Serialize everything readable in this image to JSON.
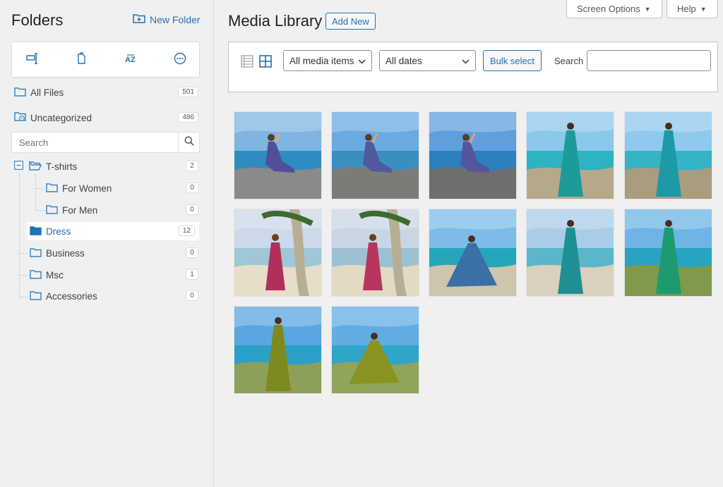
{
  "sidebar": {
    "title": "Folders",
    "new_folder_label": "New Folder",
    "all_files": {
      "label": "All Files",
      "count": "501"
    },
    "uncategorized": {
      "label": "Uncategorized",
      "count": "486"
    },
    "search_placeholder": "Search",
    "folders": [
      {
        "label": "T-shirts",
        "count": "2"
      },
      {
        "label": "For Women",
        "count": "0"
      },
      {
        "label": "For Men",
        "count": "0"
      },
      {
        "label": "Dress",
        "count": "12"
      },
      {
        "label": "Business",
        "count": "0"
      },
      {
        "label": "Msc",
        "count": "1"
      },
      {
        "label": "Accessories",
        "count": "0"
      }
    ],
    "selected_folder": "Dress"
  },
  "header": {
    "title": "Media Library",
    "add_new_label": "Add New",
    "screen_options_label": "Screen Options",
    "help_label": "Help"
  },
  "filters": {
    "media_type": "All media items",
    "dates": "All dates",
    "bulk_select_label": "Bulk select",
    "search_label": "Search"
  },
  "icons": {
    "folder": "folder-icon",
    "new_folder": "folder-plus-icon",
    "list_view": "list-view-icon",
    "grid_view": "grid-view-icon"
  },
  "colors": {
    "accent": "#2271b1",
    "selected_folder": "#2271b1",
    "folder_outline": "#3582c4"
  },
  "grid": {
    "items": [
      {
        "dress": "#4f4f9a",
        "sky": "#7fb5e0",
        "sea": "#2f8cc0",
        "ground": "#8a8a8a",
        "pose": "sit"
      },
      {
        "dress": "#4f5a9c",
        "sky": "#6aaae0",
        "sea": "#3b8fbf",
        "ground": "#7d7b78",
        "pose": "sit"
      },
      {
        "dress": "#55559e",
        "sky": "#5e9fdc",
        "sea": "#2b80bd",
        "ground": "#6f6e6c",
        "pose": "sit"
      },
      {
        "dress": "#1f9a9a",
        "sky": "#8cc7ec",
        "sea": "#2eb3c2",
        "ground": "#b6a98a",
        "pose": "stand"
      },
      {
        "dress": "#1d9aa6",
        "sky": "#8fc9ee",
        "sea": "#34b4c4",
        "ground": "#a99c7f",
        "pose": "stand"
      },
      {
        "dress": "#b0305a",
        "sky": "#cbd9e8",
        "sea": "#9fc7d6",
        "ground": "#e8ddc8",
        "pose": "palm"
      },
      {
        "dress": "#b83560",
        "sky": "#c8d6e4",
        "sea": "#9cc2d2",
        "ground": "#e4d9c2",
        "pose": "palm"
      },
      {
        "dress": "#3a6fa8",
        "sky": "#7dbce8",
        "sea": "#25a6b8",
        "ground": "#cfc4ad",
        "pose": "twirl"
      },
      {
        "dress": "#1f8f96",
        "sky": "#a9cde8",
        "sea": "#5cb5c8",
        "ground": "#d9d0be",
        "pose": "stand"
      },
      {
        "dress": "#1e9a70",
        "sky": "#6eb4e6",
        "sea": "#2aa3c0",
        "ground": "#7e9a4a",
        "pose": "stand"
      },
      {
        "dress": "#7e8a1e",
        "sky": "#5aa6e0",
        "sea": "#2aa0c8",
        "ground": "#8ca05a",
        "pose": "stand"
      },
      {
        "dress": "#8a9222",
        "sky": "#62ace4",
        "sea": "#2fa6c8",
        "ground": "#90a45c",
        "pose": "twirl"
      }
    ]
  }
}
